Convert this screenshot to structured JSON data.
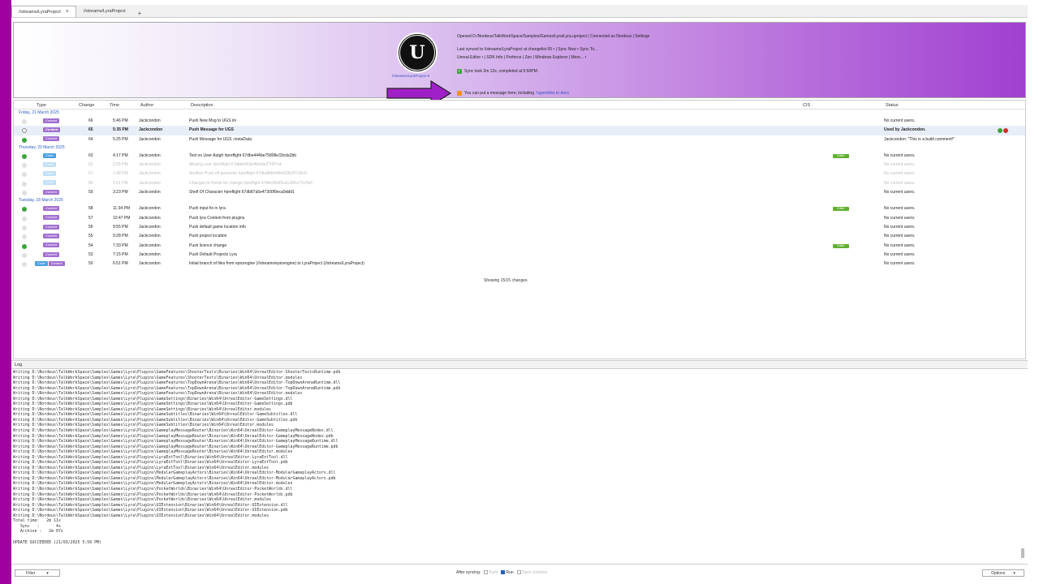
{
  "tabs": [
    {
      "label": "//streams/LyraProject"
    },
    {
      "label": "//streams/LyraProject"
    }
  ],
  "tab_close_icon": "×",
  "tab_add_icon": "+",
  "header": {
    "stream_link": "//streams/LyraProject ▾",
    "opened_line": "Opened D:/Nordeus/TalkWorkSpace/Samples/Games/Lyra/Lyra.uproject  |  Connected as Nordeus  |  Settings",
    "synced_line": "Last synced to //streams/LyraProject at changelist 65  •  |  Sync Now  •  Sync To...",
    "tools_line": "Unreal Editor  •  |  SDK Info  |  Perforce  |  Zen  |  Windows Explorer  |  More...  •",
    "sync_status": "Sync took 2m 12s, completed at 5:50PM.",
    "message_text": "You can put a message here, including",
    "message_link": "hyperlinks to docs",
    "accent_color": "#a040d0"
  },
  "columns": {
    "type": "Type",
    "change": "Change",
    "time": "Time",
    "author": "Author",
    "description": "Description",
    "cis": "CIS",
    "status": "Status"
  },
  "groups": [
    {
      "date": "Friday, 21 March 2025",
      "rows": [
        {
          "tags": [
            "Content"
          ],
          "change": "66",
          "time": "5:46 PM",
          "author": "Jackcondon",
          "desc": "Push New Msg to UGS.ini",
          "status": "No current users.",
          "style": ""
        },
        {
          "tags": [
            "Content"
          ],
          "change": "65",
          "time": "5:35 PM",
          "author": "Jackcondon",
          "desc": "Push Message for UGS",
          "status": "Used by Jackcondon.",
          "style": "sel bold"
        },
        {
          "tags": [
            "Content"
          ],
          "change": "64",
          "time": "5:25 PM",
          "author": "Jackcondon",
          "desc": "Push Message for UGS  .metaData",
          "status": "Jackcondon: \"This is a build comment!\"",
          "style": ""
        }
      ]
    },
    {
      "date": "Thursday, 20 March 2025",
      "rows": [
        {
          "tags": [
            "Code"
          ],
          "change": "63",
          "time": "4:17 PM",
          "author": "Jackcondon",
          "desc": "Test no User Autgh #preflight 67dbe444be75808e33cda2bb",
          "status": "No current users.",
          "style": "",
          "badge": "Editor"
        },
        {
          "tags": [
            "Code"
          ],
          "change": "62",
          "time": "2:55 PM",
          "author": "Jackcondon",
          "desc": "Missing user #preflight 67dbde6b3e4fedde27f3f7c4",
          "status": "No current users.",
          "style": "dim"
        },
        {
          "tags": [
            "Code"
          ],
          "change": "61",
          "time": "1:48 PM",
          "author": "Jackcondon",
          "desc": "Another Push off geocoder #preflight 67dbd84b4dfe522b3f7c5b1f",
          "status": "No current users.",
          "style": "dim"
        },
        {
          "tags": [
            "Code"
          ],
          "change": "60",
          "time": "1:01 PM",
          "author": "Jackcondon",
          "desc": "Changes to Horde for change #preflight 67dbc06ef3ca1d0fce72c0b6",
          "status": "No current users.",
          "style": "dim"
        },
        {
          "tags": [
            "Content"
          ],
          "change": "59",
          "time": "3:23 PM",
          "author": "Jackcondon",
          "desc": "Shelf Of Character #preflight 67db87a5e47300f9eca9ddd1",
          "status": "No current users.",
          "style": ""
        }
      ]
    },
    {
      "date": "Tuesday, 18 March 2025",
      "rows": [
        {
          "tags": [
            "Content"
          ],
          "change": "58",
          "time": "11:34 PM",
          "author": "Jackcondon",
          "desc": "Push input fix in lyra",
          "status": "No current users.",
          "style": "",
          "badge": "Editor"
        },
        {
          "tags": [
            "Content"
          ],
          "change": "57",
          "time": "10:47 PM",
          "author": "Jackcondon",
          "desc": "Push lyra Content from plugins",
          "status": "No current users.",
          "style": ""
        },
        {
          "tags": [
            "Content"
          ],
          "change": "56",
          "time": "9:55 PM",
          "author": "Jackcondon",
          "desc": "Push default game location info",
          "status": "No current users.",
          "style": ""
        },
        {
          "tags": [
            "Content"
          ],
          "change": "55",
          "time": "9:28 PM",
          "author": "Jackcondon",
          "desc": "Push project location",
          "status": "No current users.",
          "style": ""
        },
        {
          "tags": [
            "Content"
          ],
          "change": "54",
          "time": "7:33 PM",
          "author": "Jackcondon",
          "desc": "Push licence change",
          "status": "No current users.",
          "style": "",
          "badge": "Editor"
        },
        {
          "tags": [
            "Content"
          ],
          "change": "53",
          "time": "7:15 PM",
          "author": "Jackcondon",
          "desc": "Push Default Projects Lyra",
          "status": "No current users.",
          "style": ""
        },
        {
          "tags": [
            "Code",
            "Content"
          ],
          "change": "50",
          "time": "6:51 PM",
          "author": "Jackcondon",
          "desc": "Initial branch of files from epicengine (//streams/epicengine) to LyraProject (//streams/LyraProject)",
          "status": "No current users.",
          "style": ""
        }
      ]
    }
  ],
  "showing_text": "Showing 15/15 changes.",
  "log_title": "Log",
  "log_lines": [
    "Writing D:\\Nordeus\\TalkWorkSpace\\Samples\\Games\\Lyra\\Plugins\\GameFeatures\\ShooterTests\\Binaries\\Win64\\UnrealEditor-ShooterTestsRuntime.pdb",
    "Writing D:\\Nordeus\\TalkWorkSpace\\Samples\\Games\\Lyra\\Plugins\\GameFeatures\\ShooterTests\\Binaries\\Win64\\UnrealEditor.modules",
    "Writing D:\\Nordeus\\TalkWorkSpace\\Samples\\Games\\Lyra\\Plugins\\GameFeatures\\TopDownArena\\Binaries\\Win64\\UnrealEditor-TopDownArenaRuntime.dll",
    "Writing D:\\Nordeus\\TalkWorkSpace\\Samples\\Games\\Lyra\\Plugins\\GameFeatures\\TopDownArena\\Binaries\\Win64\\UnrealEditor-TopDownArenaRuntime.pdb",
    "Writing D:\\Nordeus\\TalkWorkSpace\\Samples\\Games\\Lyra\\Plugins\\GameFeatures\\TopDownArena\\Binaries\\Win64\\UnrealEditor.modules",
    "Writing D:\\Nordeus\\TalkWorkSpace\\Samples\\Games\\Lyra\\Plugins\\GameSettings\\Binaries\\Win64\\UnrealEditor-GameSettings.dll",
    "Writing D:\\Nordeus\\TalkWorkSpace\\Samples\\Games\\Lyra\\Plugins\\GameSettings\\Binaries\\Win64\\UnrealEditor-GameSettings.pdb",
    "Writing D:\\Nordeus\\TalkWorkSpace\\Samples\\Games\\Lyra\\Plugins\\GameSettings\\Binaries\\Win64\\UnrealEditor.modules",
    "Writing D:\\Nordeus\\TalkWorkSpace\\Samples\\Games\\Lyra\\Plugins\\GameSubtitles\\Binaries\\Win64\\UnrealEditor-GameSubtitles.dll",
    "Writing D:\\Nordeus\\TalkWorkSpace\\Samples\\Games\\Lyra\\Plugins\\GameSubtitles\\Binaries\\Win64\\UnrealEditor-GameSubtitles.pdb",
    "Writing D:\\Nordeus\\TalkWorkSpace\\Samples\\Games\\Lyra\\Plugins\\GameSubtitles\\Binaries\\Win64\\UnrealEditor.modules",
    "Writing D:\\Nordeus\\TalkWorkSpace\\Samples\\Games\\Lyra\\Plugins\\GameplayMessageRouter\\Binaries\\Win64\\UnrealEditor-GameplayMessageNodes.dll",
    "Writing D:\\Nordeus\\TalkWorkSpace\\Samples\\Games\\Lyra\\Plugins\\GameplayMessageRouter\\Binaries\\Win64\\UnrealEditor-GameplayMessageNodes.pdb",
    "Writing D:\\Nordeus\\TalkWorkSpace\\Samples\\Games\\Lyra\\Plugins\\GameplayMessageRouter\\Binaries\\Win64\\UnrealEditor-GameplayMessageRuntime.dll",
    "Writing D:\\Nordeus\\TalkWorkSpace\\Samples\\Games\\Lyra\\Plugins\\GameplayMessageRouter\\Binaries\\Win64\\UnrealEditor-GameplayMessageRuntime.pdb",
    "Writing D:\\Nordeus\\TalkWorkSpace\\Samples\\Games\\Lyra\\Plugins\\GameplayMessageRouter\\Binaries\\Win64\\UnrealEditor.modules",
    "Writing D:\\Nordeus\\TalkWorkSpace\\Samples\\Games\\Lyra\\Plugins\\LyraExtTool\\Binaries\\Win64\\UnrealEditor-LyraExtTool.dll",
    "Writing D:\\Nordeus\\TalkWorkSpace\\Samples\\Games\\Lyra\\Plugins\\LyraExtTool\\Binaries\\Win64\\UnrealEditor-LyraExtTool.pdb",
    "Writing D:\\Nordeus\\TalkWorkSpace\\Samples\\Games\\Lyra\\Plugins\\LyraExtTool\\Binaries\\Win64\\UnrealEditor.modules",
    "Writing D:\\Nordeus\\TalkWorkSpace\\Samples\\Games\\Lyra\\Plugins\\ModularGameplayActors\\Binaries\\Win64\\UnrealEditor-ModularGameplayActors.dll",
    "Writing D:\\Nordeus\\TalkWorkSpace\\Samples\\Games\\Lyra\\Plugins\\ModularGameplayActors\\Binaries\\Win64\\UnrealEditor-ModularGameplayActors.pdb",
    "Writing D:\\Nordeus\\TalkWorkSpace\\Samples\\Games\\Lyra\\Plugins\\ModularGameplayActors\\Binaries\\Win64\\UnrealEditor.modules",
    "Writing D:\\Nordeus\\TalkWorkSpace\\Samples\\Games\\Lyra\\Plugins\\PocketWorlds\\Binaries\\Win64\\UnrealEditor-PocketWorlds.dll",
    "Writing D:\\Nordeus\\TalkWorkSpace\\Samples\\Games\\Lyra\\Plugins\\PocketWorlds\\Binaries\\Win64\\UnrealEditor-PocketWorlds.pdb",
    "Writing D:\\Nordeus\\TalkWorkSpace\\Samples\\Games\\Lyra\\Plugins\\PocketWorlds\\Binaries\\Win64\\UnrealEditor.modules",
    "Writing D:\\Nordeus\\TalkWorkSpace\\Samples\\Games\\Lyra\\Plugins\\UIExtension\\Binaries\\Win64\\UnrealEditor-UIExtension.dll",
    "Writing D:\\Nordeus\\TalkWorkSpace\\Samples\\Games\\Lyra\\Plugins\\UIExtension\\Binaries\\Win64\\UnrealEditor-UIExtension.pdb",
    "Writing D:\\Nordeus\\TalkWorkSpace\\Samples\\Games\\Lyra\\Plugins\\UIExtension\\Binaries\\Win64\\UnrealEditor.modules",
    "Total time:   2m 11s",
    "   Sync   :       4s",
    "   Archive :   2m 07s",
    "",
    "UPDATE SUCCEEDED (21/03/2025 5:50 PM)"
  ],
  "footer": {
    "filter_label": "Filter",
    "after_syncing": "After syncing:",
    "build_label": "Build",
    "run_label": "Run",
    "open_solution_label": "Open Solution",
    "options_label": "Options",
    "dropdown_icon": "▾"
  }
}
